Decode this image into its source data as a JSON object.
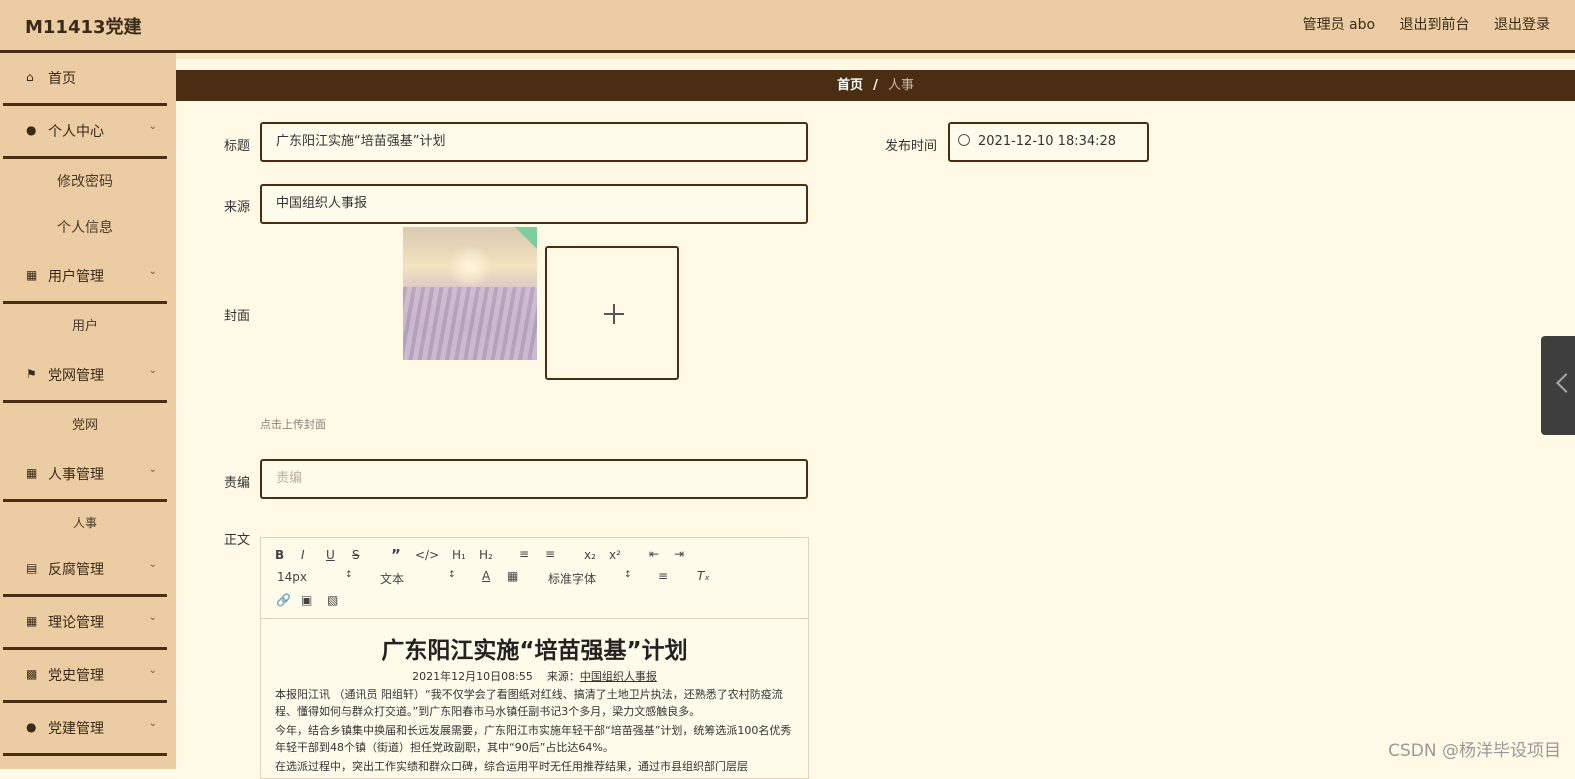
{
  "app": {
    "title": "M11413党建"
  },
  "header": {
    "user": "管理员 abo",
    "to_front": "退出到前台",
    "logout": "退出登录"
  },
  "sidebar": {
    "items": [
      {
        "label": "首页",
        "icon": "home-icon"
      },
      {
        "label": "个人中心",
        "icon": "user-icon",
        "sub": [
          "修改密码",
          "个人信息"
        ]
      },
      {
        "label": "用户管理",
        "icon": "grid-icon",
        "sub": [
          "用户"
        ]
      },
      {
        "label": "党网管理",
        "icon": "flag-icon",
        "sub": [
          "党网"
        ]
      },
      {
        "label": "人事管理",
        "icon": "grid-icon",
        "sub": [
          "人事"
        ]
      },
      {
        "label": "反腐管理",
        "icon": "clipboard-icon"
      },
      {
        "label": "理论管理",
        "icon": "grid-icon"
      },
      {
        "label": "党史管理",
        "icon": "chat-icon"
      },
      {
        "label": "党建管理",
        "icon": "bulb-icon"
      }
    ]
  },
  "breadcrumb": {
    "home": "首页",
    "sep": "/",
    "current": "人事"
  },
  "form": {
    "title_label": "标题",
    "title_value": "广东阳江实施“培苗强基”计划",
    "publish_label": "发布时间",
    "publish_value": "2021-12-10 18:34:28",
    "source_label": "来源",
    "source_value": "中国组织人事报",
    "cover_label": "封面",
    "cover_hint": "点击上传封面",
    "editor_label": "责编",
    "editor_placeholder": "责编",
    "body_label": "正文"
  },
  "editor": {
    "toolbar": {
      "font_size": "14px",
      "block": "文本",
      "font_family": "标准字体"
    },
    "content": {
      "heading": "广东阳江实施“培苗强基”计划",
      "meta_date": "2021年12月10日08:55",
      "meta_source_label": "来源：",
      "meta_source": "中国组织人事报",
      "p1": "本报阳江讯 （通讯员 阳组轩）“我不仅学会了看图纸对红线、搞清了土地卫片执法，还熟悉了农村防疫流程、懂得如何与群众打交道。”到广东阳春市马水镇任副书记3个多月，梁力文感触良多。",
      "p2": "今年，结合乡镇集中换届和长远发展需要，广东阳江市实施年轻干部“培苗强基”计划，统筹选派100名优秀年轻干部到48个镇（街道）担任党政副职，其中“90后”占比达64%。",
      "p3": "在选派过程中，突出工作实绩和群众口碑，综合运用平时无任用推荐结果，通过市县组织部门层层"
    }
  },
  "watermark": "CSDN @杨洋毕设项目"
}
